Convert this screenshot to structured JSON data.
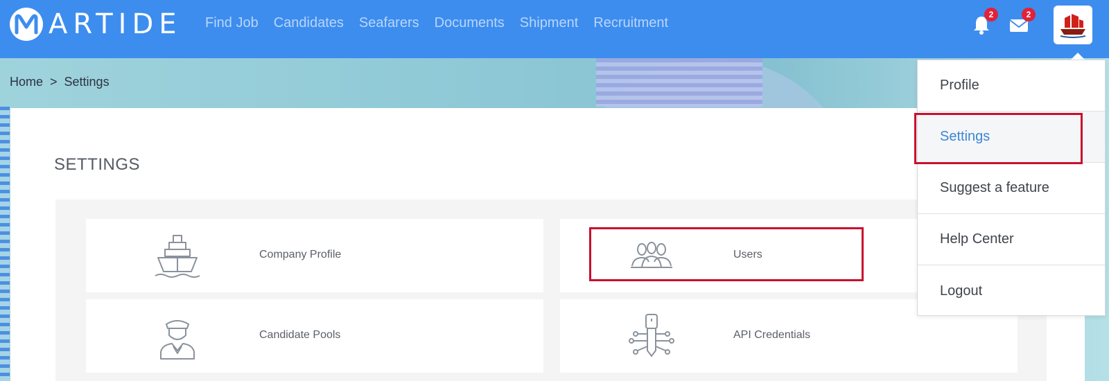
{
  "brand": {
    "name": "ARTIDE"
  },
  "nav": {
    "items": [
      "Find Job",
      "Candidates",
      "Seafarers",
      "Documents",
      "Shipment",
      "Recruitment"
    ]
  },
  "notifications": {
    "count": "2"
  },
  "messages": {
    "count": "2"
  },
  "breadcrumb": {
    "home": "Home",
    "separator": ">",
    "current": "Settings"
  },
  "page": {
    "title": "SETTINGS"
  },
  "tiles": [
    {
      "label": "Company Profile",
      "icon": "ship-icon"
    },
    {
      "label": "Users",
      "icon": "users-icon"
    },
    {
      "label": "Candidate Pools",
      "icon": "sailor-icon"
    },
    {
      "label": "API Credentials",
      "icon": "key-circuit-icon"
    }
  ],
  "menu": {
    "items": [
      "Profile",
      "Settings",
      "Suggest a feature",
      "Help Center",
      "Logout"
    ],
    "active": "Settings"
  },
  "colors": {
    "topbar": "#3d8def",
    "highlight": "#c8102e",
    "active_text": "#3b86d4"
  }
}
